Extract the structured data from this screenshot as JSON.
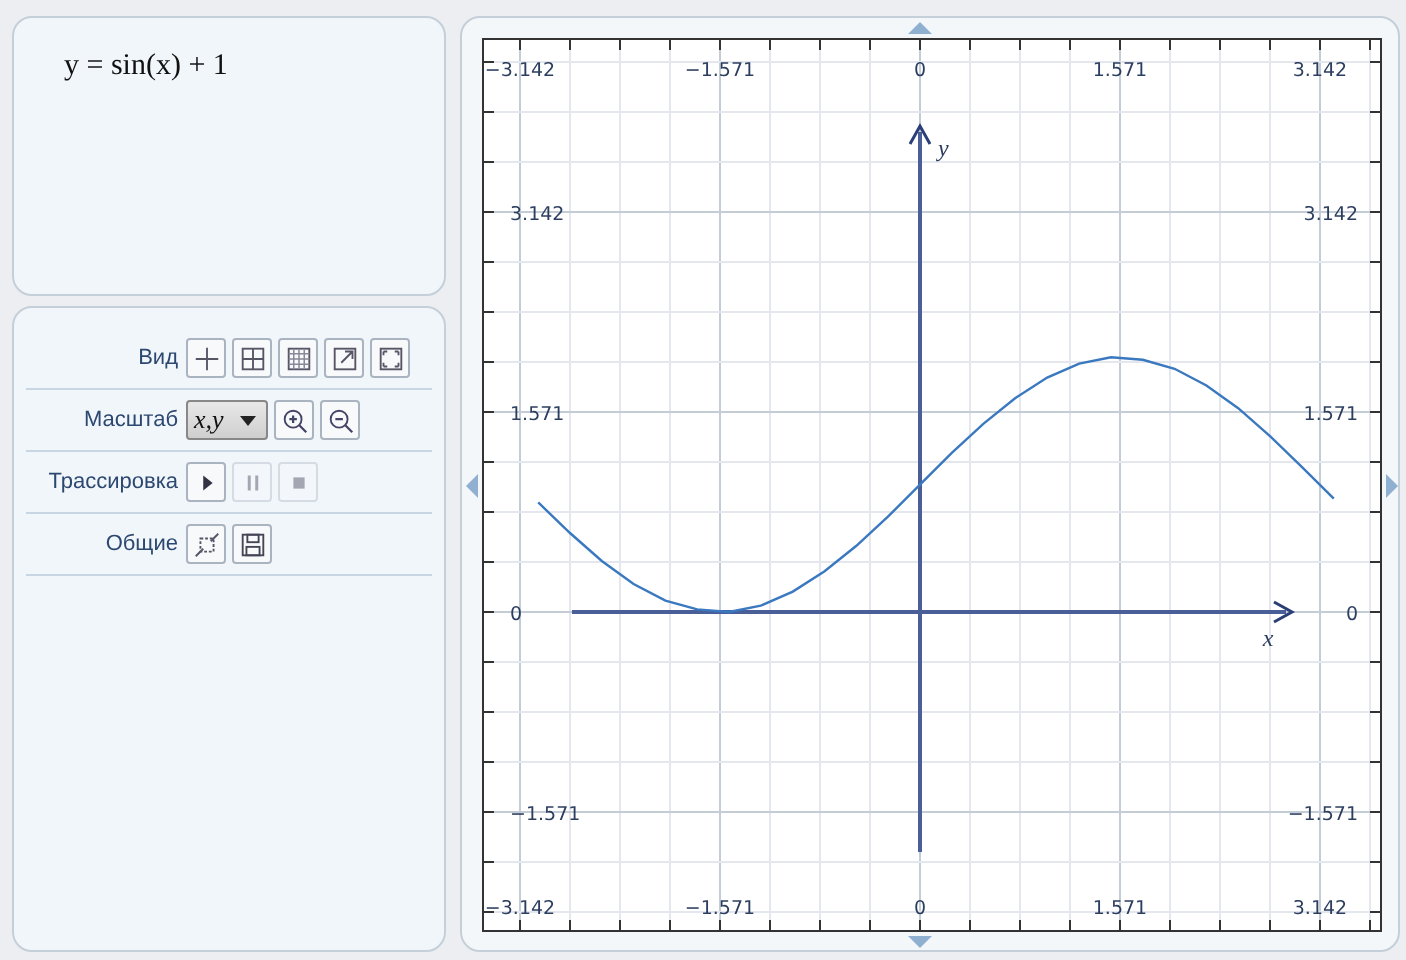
{
  "formula": "y = sin(x) + 1",
  "toolbar": {
    "rows": [
      {
        "label": "Вид",
        "controls": [
          {
            "kind": "axes",
            "disabled": false
          },
          {
            "kind": "grid-coarse",
            "disabled": false
          },
          {
            "kind": "grid-fine",
            "disabled": false
          },
          {
            "kind": "expand",
            "disabled": false
          },
          {
            "kind": "fit",
            "disabled": false
          }
        ]
      },
      {
        "label": "Масштаб",
        "controls": [
          {
            "kind": "select",
            "value": "x,y"
          },
          {
            "kind": "zoom-in",
            "disabled": false
          },
          {
            "kind": "zoom-out",
            "disabled": false
          }
        ]
      },
      {
        "label": "Трассировка",
        "controls": [
          {
            "kind": "play",
            "disabled": false
          },
          {
            "kind": "pause",
            "disabled": true
          },
          {
            "kind": "stop",
            "disabled": true
          }
        ]
      },
      {
        "label": "Общие",
        "controls": [
          {
            "kind": "export",
            "disabled": false
          },
          {
            "kind": "save",
            "disabled": false
          }
        ]
      }
    ]
  },
  "plot": {
    "chart_data": {
      "type": "line",
      "xlabel": "x",
      "ylabel": "y",
      "xlim": [
        -3.44,
        3.63
      ],
      "ylim": [
        -2.51,
        4.51
      ],
      "grid": true,
      "x": [
        -3.0,
        -2.75,
        -2.5,
        -2.25,
        -2.0,
        -1.75,
        -1.5,
        -1.25,
        -1.0,
        -0.75,
        -0.5,
        -0.25,
        0,
        0.25,
        0.5,
        0.75,
        1.0,
        1.25,
        1.5,
        1.75,
        2.0,
        2.25,
        2.5,
        2.75,
        3.0,
        3.25
      ],
      "series": [
        {
          "color": "#3a78c0",
          "values": [
            0.86,
            0.62,
            0.4,
            0.22,
            0.09,
            0.02,
            0,
            0.05,
            0.16,
            0.32,
            0.52,
            0.75,
            1,
            1.25,
            1.48,
            1.68,
            1.84,
            1.95,
            2,
            1.98,
            1.91,
            1.78,
            1.6,
            1.38,
            1.14,
            0.89
          ]
        }
      ],
      "xticks": [
        {
          "value": -3.142,
          "label": "−3.142"
        },
        {
          "value": -1.571,
          "label": "−1.571"
        },
        {
          "value": 0,
          "label": "0"
        },
        {
          "value": 1.571,
          "label": "1.571"
        },
        {
          "value": 3.142,
          "label": "3.142"
        }
      ],
      "yticks": [
        {
          "value": 3.142,
          "label": "3.142"
        },
        {
          "value": 1.571,
          "label": "1.571"
        },
        {
          "value": 0,
          "label": "0"
        },
        {
          "value": -1.571,
          "label": "−1.571"
        }
      ]
    }
  }
}
